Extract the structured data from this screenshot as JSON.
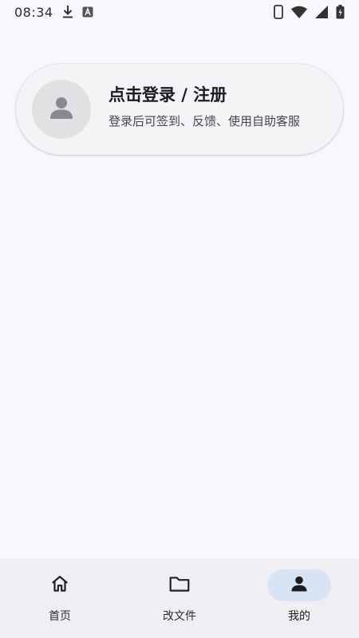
{
  "status_bar": {
    "time": "08:34",
    "left_icons": [
      "download-icon",
      "font-a-icon"
    ],
    "right_icons": [
      "phone-icon",
      "wifi-icon",
      "signal-icon",
      "battery-charging-icon"
    ]
  },
  "login_card": {
    "title": "点击登录 / 注册",
    "subtitle": "登录后可签到、反馈、使用自助客服",
    "avatar_icon": "person-icon"
  },
  "bottom_nav": {
    "items": [
      {
        "label": "首页",
        "icon": "home-icon",
        "active": false
      },
      {
        "label": "改文件",
        "icon": "folder-icon",
        "active": false
      },
      {
        "label": "我的",
        "icon": "person-icon",
        "active": true
      }
    ]
  },
  "colors": {
    "background": "#f8f7fc",
    "card": "#f4f3f6",
    "avatar_bg": "#e1e1e3",
    "nav_bg": "#efeef3",
    "nav_active_pill": "#d9e3f6"
  }
}
